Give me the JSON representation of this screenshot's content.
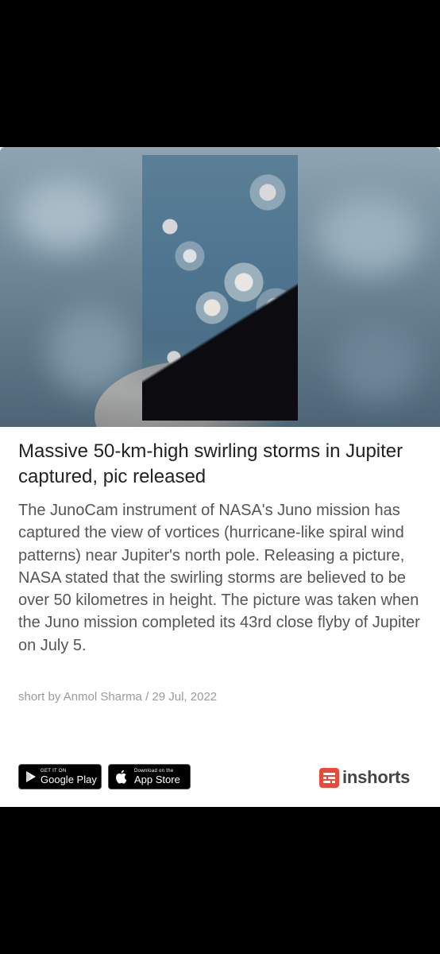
{
  "article": {
    "title": "Massive 50-km-high swirling storms in Jupiter captured, pic released",
    "body": "The JunoCam instrument of NASA's Juno mission has captured the view of vortices (hurricane-like spiral wind patterns) near Jupiter's north pole. Releasing a picture, NASA stated that the swirling storms are believed to be over 50 kilometres in height. The picture was taken when the Juno mission completed its 43rd close flyby of Jupiter on July 5.",
    "byline": "short by Anmol Sharma / 29 Jul, 2022"
  },
  "footer": {
    "google_play": {
      "small": "GET IT ON",
      "big": "Google Play"
    },
    "app_store": {
      "small": "Download on the",
      "big": "App Store"
    },
    "brand": "inshorts"
  },
  "colors": {
    "brand_red": "#e84a3a",
    "card_bg": "#ffffff",
    "screen_bg": "#000000"
  }
}
